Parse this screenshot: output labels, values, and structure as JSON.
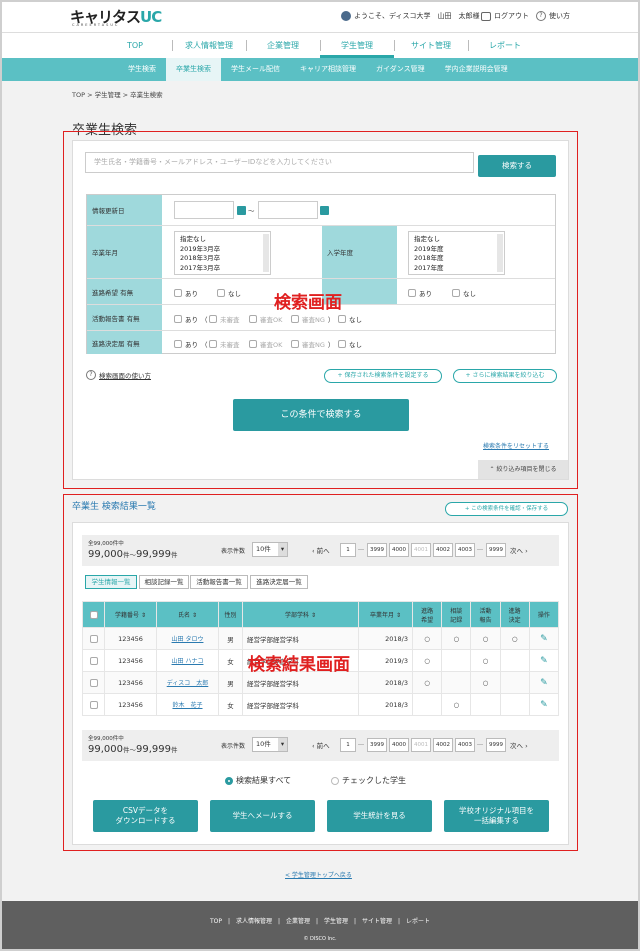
{
  "header": {
    "logo_main": "キャリタス",
    "logo_uc": "UC",
    "logo_sub": "CAREERTASUC",
    "welcome": "ようこそ、ディスコ大学　山田　太郎様",
    "logout": "ログアウト",
    "help": "使い方"
  },
  "gnav": [
    "TOP",
    "求人情報管理",
    "企業管理",
    "学生管理",
    "サイト管理",
    "レポート"
  ],
  "subnav": [
    "学生検索",
    "卒業生検索",
    "学生メール配信",
    "キャリア相談管理",
    "ガイダンス管理",
    "学内企業説明会管理"
  ],
  "breadcrumb": "TOP > 学生管理 > 卒業生検索",
  "page_title": "卒業生検索",
  "search": {
    "placeholder": "学生氏名・学籍番号・メールアドレス・ユーザーIDなどを入力してください",
    "button": "検索する"
  },
  "conditions": {
    "update_date": "情報更新日",
    "tilde": "～",
    "grad_ym": "卒業年月",
    "grad_options": [
      "指定なし",
      "2019年3月卒",
      "2018年3月卒",
      "2017年3月卒"
    ],
    "enroll_year": "入学年度",
    "enroll_options": [
      "指定なし",
      "2019年度",
      "2018年度",
      "2017年度"
    ],
    "career_wish": "進路希望 有無",
    "report": "活動報告書 有無",
    "decision": "進路決定届 有無",
    "ari": "あり",
    "nashi": "なし",
    "paren_open": "（",
    "paren_close": "）",
    "unreviewed": "未審査",
    "review_ok": "審査OK",
    "review_ng": "審査NG"
  },
  "links": {
    "howto": "検索画面の使い方",
    "save_cond": "保存された検索条件を設定する",
    "narrow": "さらに検索結果を絞り込む",
    "reset": "検索条件をリセットする",
    "close": "絞り込み項目を閉じる",
    "back": "< 学生管理トップへ戻る"
  },
  "search_button": "この条件で検索する",
  "annot_search": "検索画面",
  "annot_results": "検索結果画面",
  "results": {
    "title": "卒業生 検索結果一覧",
    "confirm_save": "この検索条件を確認・保存する",
    "total_small": "全99,000件中",
    "range": "99,000",
    "range_unit1": "件～",
    "range_end": "99,999",
    "range_unit2": "件",
    "per_page_label": "表示件数",
    "per_page": "10件",
    "prev": "前へ",
    "next": "次へ",
    "ellipsis": "…",
    "pages": [
      "1",
      "3999",
      "4000",
      "4001",
      "4002",
      "4003",
      "9999"
    ],
    "tabs": [
      "学生情報一覧",
      "相談記録一覧",
      "活動報告書一覧",
      "進路決定届一覧"
    ],
    "headers": [
      "学籍番号",
      "氏名",
      "性別",
      "学部学科",
      "卒業年月",
      "進路\n希望",
      "相談\n記録",
      "活動\n報告",
      "進路\n決定",
      "操作"
    ],
    "rows": [
      {
        "id": "123456",
        "name": "山田 タロウ",
        "sex": "男",
        "dept": "経営学部経営学科",
        "ym": "2018/3",
        "c1": "○",
        "c2": "○",
        "c3": "○",
        "c4": "○"
      },
      {
        "id": "123456",
        "name": "山田 ハナコ",
        "sex": "女",
        "dept": "経営学部経営学科",
        "ym": "2019/3",
        "c1": "○",
        "c2": "",
        "c3": "○",
        "c4": ""
      },
      {
        "id": "123456",
        "name": "ディスコ　太郎",
        "sex": "男",
        "dept": "経営学部経営学科",
        "ym": "2018/3",
        "c1": "○",
        "c2": "",
        "c3": "○",
        "c4": ""
      },
      {
        "id": "123456",
        "name": "鈴木　花子",
        "sex": "女",
        "dept": "経営学部経営学科",
        "ym": "2018/3",
        "c1": "",
        "c2": "○",
        "c3": "",
        "c4": ""
      }
    ],
    "radio_all": "検索結果すべて",
    "radio_checked": "チェックした学生",
    "buttons": [
      "CSVデータを\nダウンロードする",
      "学生へメールする",
      "学生統計を見る",
      "学校オリジナル項目を\n一括編集する"
    ]
  },
  "footer": {
    "nav": "TOP　|　求人情報管理　|　企業管理　|　学生管理　|　サイト管理　|　レポート",
    "copyright": "© DISCO Inc."
  }
}
